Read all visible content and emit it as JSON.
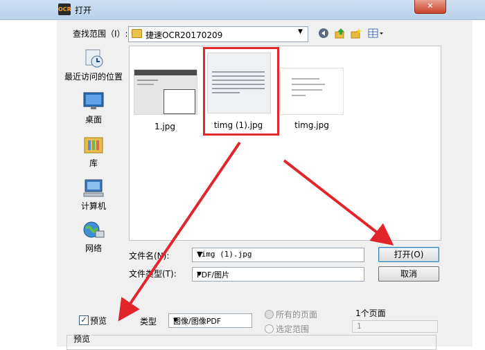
{
  "window": {
    "title": "打开",
    "logo_text": "OCR",
    "close_label": "✕"
  },
  "toolbar": {
    "lookin_label": "查找范围（I）:",
    "lookin_value": "捷速OCR20170209"
  },
  "places": [
    {
      "label": "最近访问的位置"
    },
    {
      "label": "桌面"
    },
    {
      "label": "库"
    },
    {
      "label": "计算机"
    },
    {
      "label": "网络"
    }
  ],
  "files": [
    {
      "name": "1.jpg"
    },
    {
      "name": "timg (1).jpg",
      "selected": true
    },
    {
      "name": "timg.jpg"
    }
  ],
  "form": {
    "filename_label": "文件名(N):",
    "filename_value": "timg (1).jpg",
    "filetype_label": "文件类型(T):",
    "filetype_value": "PDF/图片",
    "open_label": "打开(O)",
    "cancel_label": "取消"
  },
  "options": {
    "preview_label": "预览",
    "preview_checked": true,
    "type_label": "类型",
    "type_value": "图像/图像PDF",
    "all_pages_label": "所有的页面",
    "select_range_label": "选定范围",
    "page_count_label": "1个页面",
    "range_value": "1",
    "preview_section_label": "预览"
  },
  "colors": {
    "annotation": "#e0262a",
    "titlebar": "#c4d8ef"
  }
}
